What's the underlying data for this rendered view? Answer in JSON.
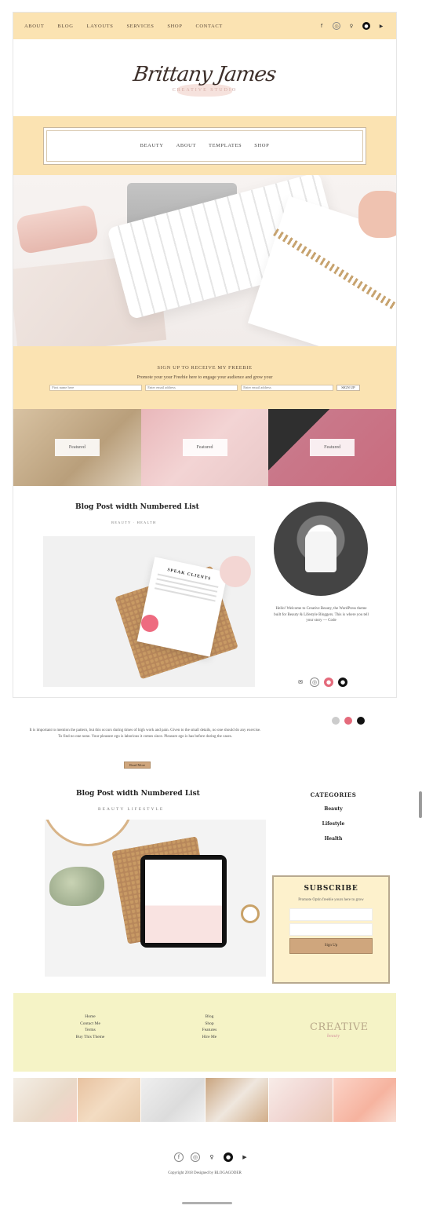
{
  "nav": {
    "links": [
      "ABOUT",
      "BLOG",
      "LAYOUTS",
      "SERVICES",
      "SHOP",
      "CONTACT"
    ],
    "social": [
      "f",
      "◎",
      "♀",
      "●",
      "▶"
    ]
  },
  "logo": {
    "script": "Brittany James",
    "sub": "CREATIVE STUDIO"
  },
  "menu": [
    "BEAUTY",
    "ABOUT",
    "TEMPLATES",
    "SHOP"
  ],
  "optin": {
    "heading": "SIGN UP TO RECEIVE MY FREEBIE",
    "text": "Promote your your Freebie here to engage your audience and grow your",
    "first_placeholder": "First name here",
    "last_placeholder": "Enter email address",
    "email_placeholder": "Enter email address",
    "button": "SIGN UP"
  },
  "tiles": [
    "Featured",
    "Featured",
    "Featured"
  ],
  "post1": {
    "title": "Blog Post width Numbered List",
    "meta": "BEAUTY · HEALTH",
    "paper_title": "SPEAK CLIENTS"
  },
  "bio": "Hello! Welcome to Creative Beauty, the WordPress theme built for Beauty & Lifestyle Bloggers. This is where you tell your story — Code",
  "side_icons": [
    "✉",
    "◎",
    "●",
    "●"
  ],
  "snippet": "It is important to mention the pattern, but this occurs during times of high work and pain. Given to the small details, no one should do any exercise. To find no one none. Your pleasure ego is laborious it comes since. Pleasure ego is has before during the cases.",
  "read_more": "Read More",
  "post2": {
    "title": "Blog Post width Numbered List",
    "meta": "BEAUTY LIFESTYLE"
  },
  "categories": {
    "title": "CATEGORIES",
    "items": [
      "Beauty",
      "Lifestyle",
      "Health"
    ]
  },
  "subscribe": {
    "title": "SUBSCRIBE",
    "text": "Promote Optin freebie yours here to grow",
    "button": "Sign Up"
  },
  "footer": {
    "col1": [
      "Home",
      "Contact Me",
      "Terms",
      "Buy This Theme"
    ],
    "col2": [
      "Blog",
      "Shop",
      "Features",
      "Hire Me"
    ],
    "logo": "CREATIVE",
    "logo_sub": "beauty"
  },
  "footer_social": [
    "f",
    "◎",
    "♀",
    "●",
    "▶"
  ],
  "copyright": "Copyright 2018 Designed by BLOGAGODER",
  "colors": {
    "peach": "#fbe3b2",
    "butter": "#f5f3c6",
    "tan": "#cfa67d"
  }
}
